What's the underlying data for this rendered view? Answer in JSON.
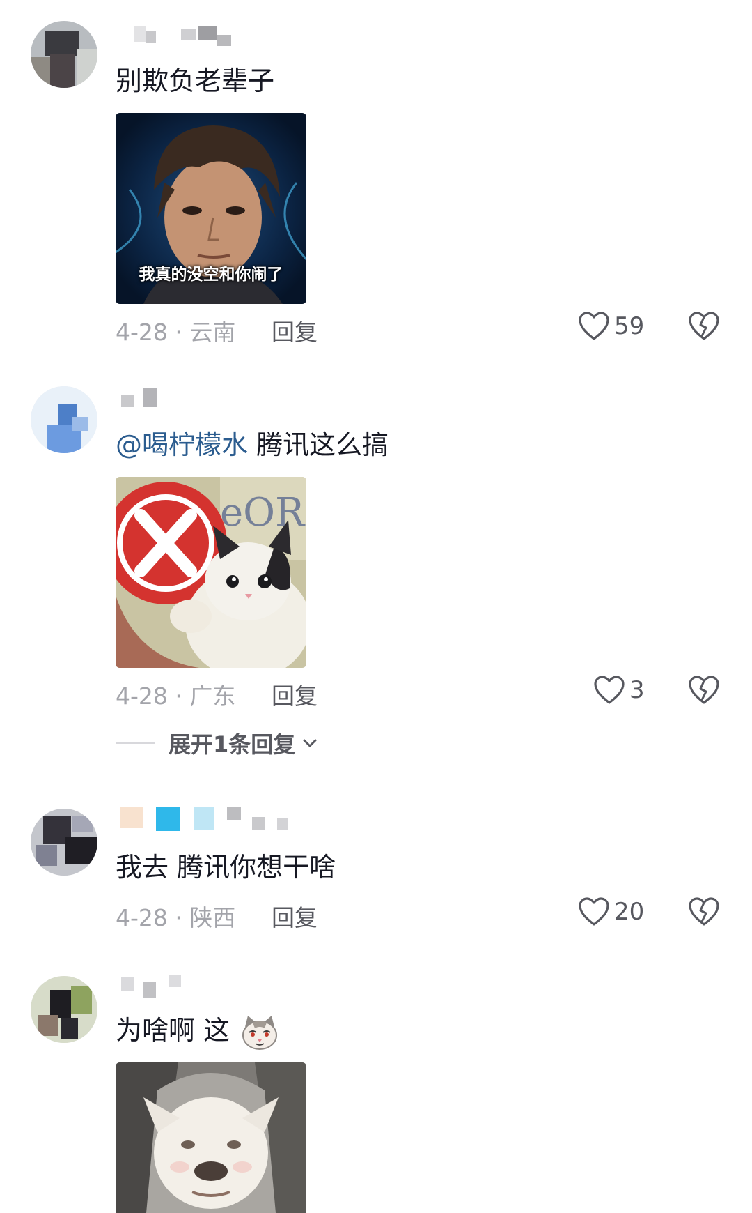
{
  "comments": [
    {
      "text": "别欺负老辈子",
      "sticker": {
        "caption": "我真的没空和你闹了"
      },
      "date_location": "4-28 · 云南",
      "reply_label": "回复",
      "likes": "59"
    },
    {
      "mention": "@喝柠檬水",
      "text": " 腾讯这么搞",
      "sticker": {
        "caption": ""
      },
      "date_location": "4-28 · 广东",
      "reply_label": "回复",
      "likes": "3",
      "expand_label": "展开1条回复"
    },
    {
      "text": "我去 腾讯你想干啥",
      "date_location": "4-28 · 陕西",
      "reply_label": "回复",
      "likes": "20"
    },
    {
      "text": "为啥啊 这",
      "emoji": "cat-face-emoji",
      "sticker": {
        "caption": ""
      }
    }
  ],
  "icons": {
    "like": "heart-outline-icon",
    "dislike": "broken-heart-icon",
    "expand": "chevron-down-icon"
  },
  "colors": {
    "mention": "#2b5c8f",
    "meta": "#a3a4aa",
    "action": "#57585f"
  }
}
